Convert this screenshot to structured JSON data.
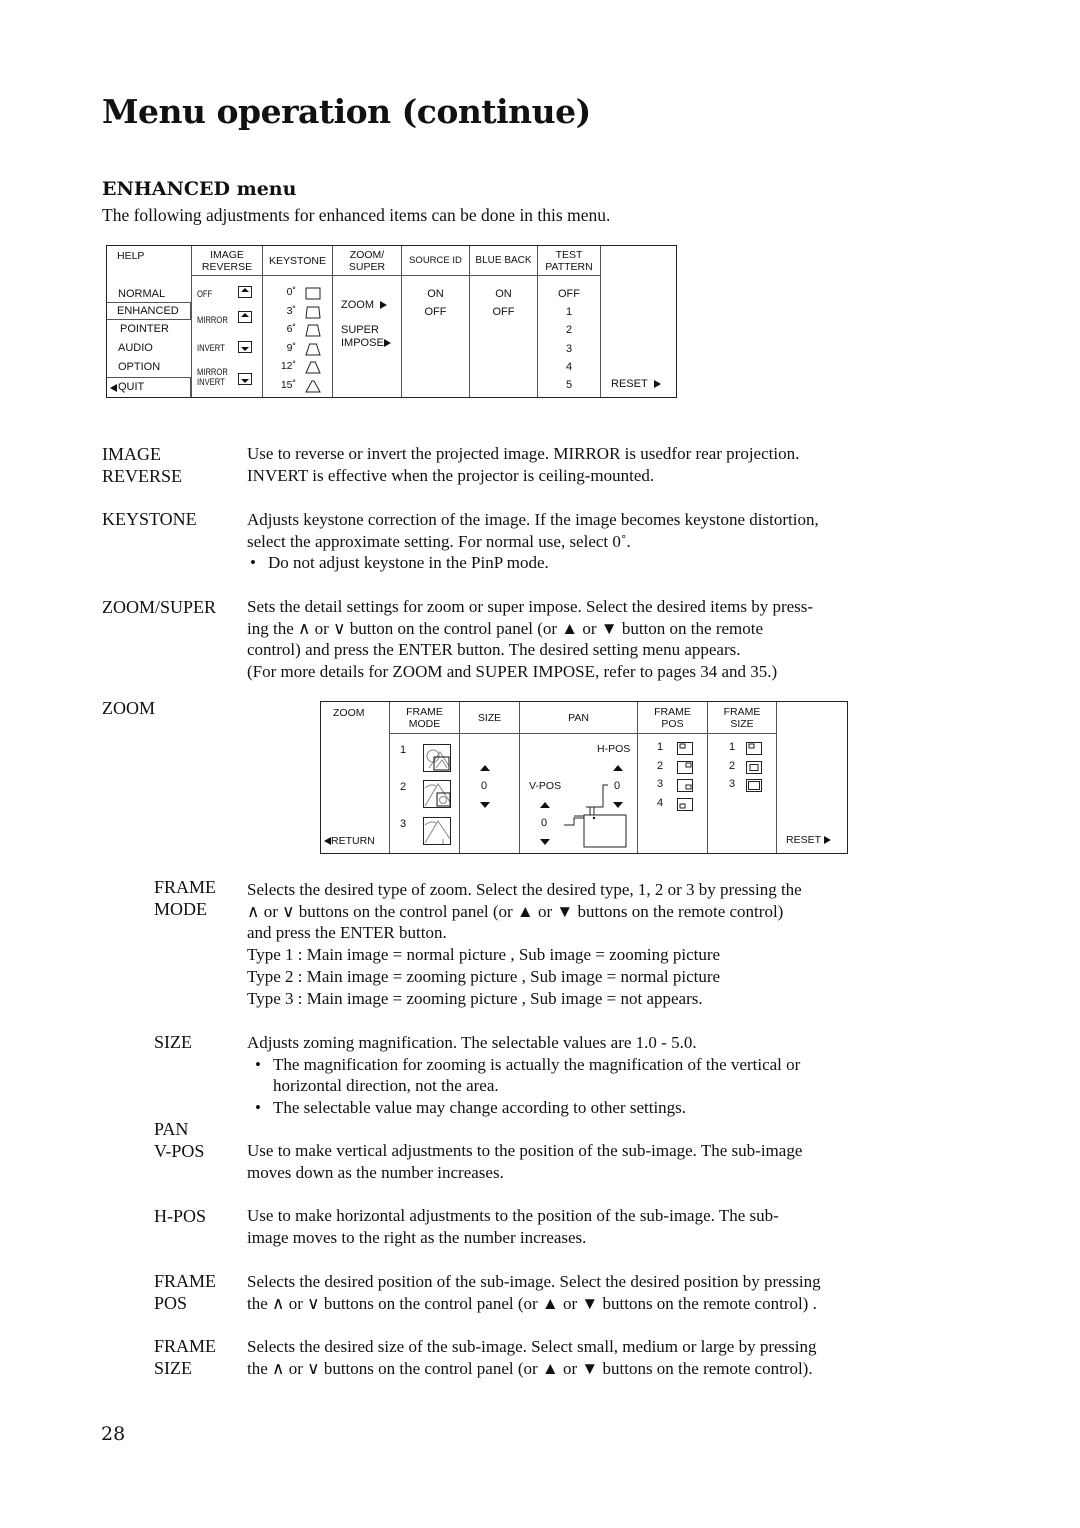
{
  "page": {
    "title": "Menu operation (continue)",
    "section_title": "ENHANCED menu",
    "intro": "The following adjustments for enhanced items can be done in this menu.",
    "page_number": "28"
  },
  "enhanced_menu": {
    "headers": {
      "help": "HELP",
      "image_reverse": [
        "IMAGE",
        "REVERSE"
      ],
      "keystone": "KEYSTONE",
      "zoom_super": [
        "ZOOM/",
        "SUPER"
      ],
      "source_id": "SOURCE ID",
      "blue_back": "BLUE BACK",
      "test_pattern": [
        "TEST",
        "PATTERN"
      ]
    },
    "help_items": [
      "NORMAL",
      "ENHANCED",
      "POINTER",
      "AUDIO",
      "OPTION",
      "QUIT"
    ],
    "help_selected": "ENHANCED",
    "image_reverse_options": [
      {
        "label": "OFF",
        "icon": "arrow-up-box-icon"
      },
      {
        "label": "MIRROR",
        "icon": "arrow-up-box-icon"
      },
      {
        "label": "INVERT",
        "icon": "arrow-down-box-icon"
      },
      {
        "label": "MIRROR INVERT",
        "icon": "arrow-down-box-icon",
        "lines": [
          "MIRROR",
          "INVERT"
        ]
      }
    ],
    "keystone_options": [
      "0˚",
      "3˚",
      "6˚",
      "9˚",
      "12˚",
      "15˚"
    ],
    "zoom_super_options": [
      "ZOOM",
      "SUPER",
      "IMPOSE"
    ],
    "source_id_options": [
      "ON",
      "OFF"
    ],
    "blue_back_options": [
      "ON",
      "OFF"
    ],
    "test_pattern_options": [
      "OFF",
      "1",
      "2",
      "3",
      "4",
      "5"
    ],
    "reset_label": "RESET"
  },
  "descriptions": [
    {
      "label": [
        "IMAGE",
        "REVERSE"
      ],
      "lines": [
        "Use to reverse or invert the projected image. MIRROR is usedfor rear projection.",
        "INVERT is effective when the projector is ceiling-mounted."
      ]
    },
    {
      "label": [
        "KEYSTONE"
      ],
      "lines": [
        "Adjusts keystone correction of the image. If the image becomes keystone distortion,",
        "select the approximate setting. For normal use, select 0˚."
      ],
      "bullets": [
        "Do not adjust keystone in the PinP mode."
      ]
    },
    {
      "label": [
        "ZOOM/SUPER"
      ],
      "lines": [
        "Sets the detail settings for zoom or super impose. Select the desired items by press-",
        "ing the ∧ or ∨ button on the control panel (or ▲ or ▼ button on the remote",
        "control) and press the ENTER button. The desired setting menu appears.",
        "(For more details for ZOOM and SUPER IMPOSE, refer to pages 34 and 35.)"
      ]
    },
    {
      "label": [
        "ZOOM"
      ]
    }
  ],
  "zoom_menu": {
    "headers": {
      "zoom": "ZOOM",
      "frame_mode": [
        "FRAME",
        "MODE"
      ],
      "size": "SIZE",
      "pan": "PAN",
      "frame_pos": [
        "FRAME",
        "POS"
      ],
      "frame_size": [
        "FRAME",
        "SIZE"
      ]
    },
    "return_label": "RETURN",
    "frame_mode_options": [
      "1",
      "2",
      "3"
    ],
    "size_value": "0",
    "pan": {
      "h_label": "H-POS",
      "h_value": "0",
      "v_label": "V-POS",
      "v_value": "0"
    },
    "frame_pos_options": [
      "1",
      "2",
      "3",
      "4"
    ],
    "frame_size_options": [
      "1",
      "2",
      "3"
    ],
    "reset_label": "RESET"
  },
  "zoom_descriptions": [
    {
      "label": [
        "FRAME",
        "MODE"
      ],
      "lines": [
        "Selects the desired type of zoom. Select the desired type, 1, 2 or 3 by pressing the",
        "∧ or ∨ buttons on the control panel (or ▲ or ▼ buttons on the remote control)",
        "and press the ENTER button.",
        "Type 1 :  Main image = normal picture , Sub image = zooming picture",
        "Type 2 :  Main image = zooming picture , Sub image = normal picture",
        "Type 3 :  Main image = zooming picture , Sub image = not appears."
      ]
    },
    {
      "label": [
        "SIZE"
      ],
      "lines": [
        "Adjusts zoming magnification. The selectable values are 1.0 - 5.0."
      ],
      "bullets": [
        "The magnification for zooming is actually the magnification of the vertical or",
        "horizontal direction, not the area.",
        "The selectable value may change according to other settings."
      ]
    },
    {
      "label": [
        "PAN",
        "V-POS"
      ],
      "lines": [
        "Use to make vertical adjustments to the position of the sub-image. The sub-image",
        "moves down as the number increases."
      ]
    },
    {
      "label": [
        "H-POS"
      ],
      "lines": [
        "Use to make horizontal adjustments to the position of the sub-image. The sub-",
        "image moves to the right as the number increases."
      ]
    },
    {
      "label": [
        "FRAME",
        "POS"
      ],
      "lines": [
        "Selects the desired position of the sub-image. Select the desired position by pressing",
        "the ∧ or ∨ buttons on the control panel (or ▲ or ▼ buttons on the remote control) ."
      ]
    },
    {
      "label": [
        "FRAME",
        "SIZE"
      ],
      "lines": [
        "Selects the desired size of the sub-image. Select small, medium or large by pressing",
        "the ∧ or ∨ buttons on the control panel (or ▲ or ▼ buttons on the remote control)."
      ]
    }
  ]
}
